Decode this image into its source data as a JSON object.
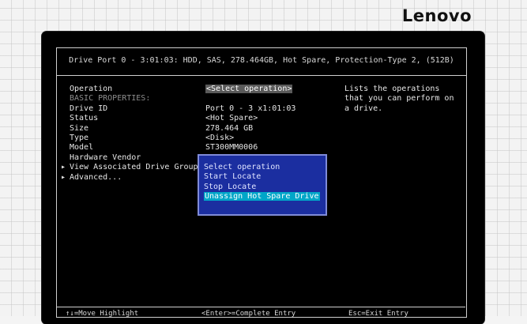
{
  "brand": {
    "logo": "Lenovo"
  },
  "window": {
    "title": "Drive Port 0 - 3:01:03: HDD, SAS, 278.464GB, Hot Spare, Protection-Type 2, (512B)"
  },
  "labels": {
    "operation": "Operation",
    "basic_properties": "BASIC PROPERTIES:",
    "drive_id": "Drive ID",
    "status": "Status",
    "size": "Size",
    "type": "Type",
    "model": "Model",
    "hardware_vendor": "Hardware Vendor",
    "view_groups": "View Associated Drive Groups",
    "advanced": "Advanced...",
    "submenu_marker": "▸"
  },
  "values": {
    "operation": "<Select operation>",
    "drive_id": "Port 0 - 3 x1:01:03",
    "status": "<Hot Spare>",
    "size": "278.464 GB",
    "type": "<Disk>",
    "model": "ST300MM0006"
  },
  "help": {
    "text": "Lists the operations that you can perform on a drive."
  },
  "popup": {
    "options": [
      "Select operation",
      "Start Locate",
      "Stop Locate",
      "Unassign Hot Spare Drive"
    ],
    "highlighted_index": 3
  },
  "hints": {
    "move": "↑↓=Move Highlight",
    "enter": "<Enter>=Complete Entry",
    "esc": "Esc=Exit Entry"
  },
  "colors": {
    "screen_bg": "#000000",
    "popup_bg": "#1b2ea0",
    "highlight": "#00a6c8"
  }
}
